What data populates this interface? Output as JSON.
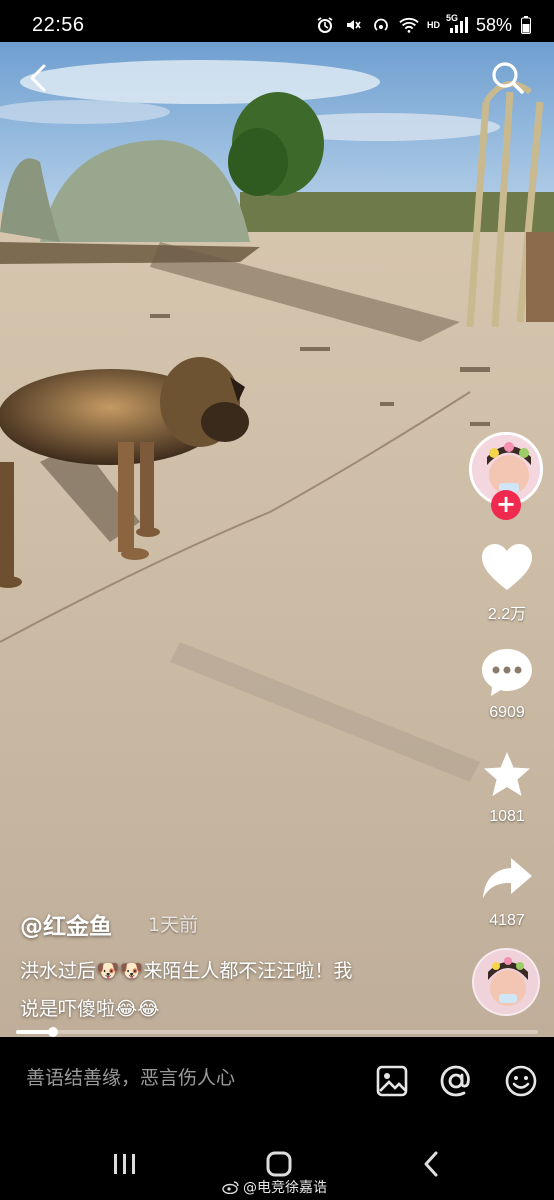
{
  "status_bar": {
    "time": "22:56",
    "network": "HD",
    "signal_type": "5G",
    "battery": "58%"
  },
  "video": {
    "author": "@红金鱼",
    "time_ago": "1天前",
    "caption_line1": "洪水过后🐶🐶来陌生人都不汪汪啦！我",
    "caption_line2": "说是吓傻啦😂😂",
    "progress": 0.07
  },
  "actions": {
    "follow": "+",
    "likes": "2.2万",
    "comments": "6909",
    "favorites": "1081",
    "shares": "4187"
  },
  "comment_bar": {
    "placeholder": "善语结善缘，恶言伤人心"
  },
  "watermark": "@电竞徐嘉诰",
  "colors": {
    "follow_red": "#f0294e",
    "background": "#000000"
  },
  "icons": [
    "back-icon",
    "search-icon",
    "heart-icon",
    "comment-icon",
    "star-icon",
    "share-icon",
    "image-icon",
    "at-icon",
    "emoji-icon",
    "recents-icon",
    "home-icon",
    "nav-back-icon"
  ]
}
